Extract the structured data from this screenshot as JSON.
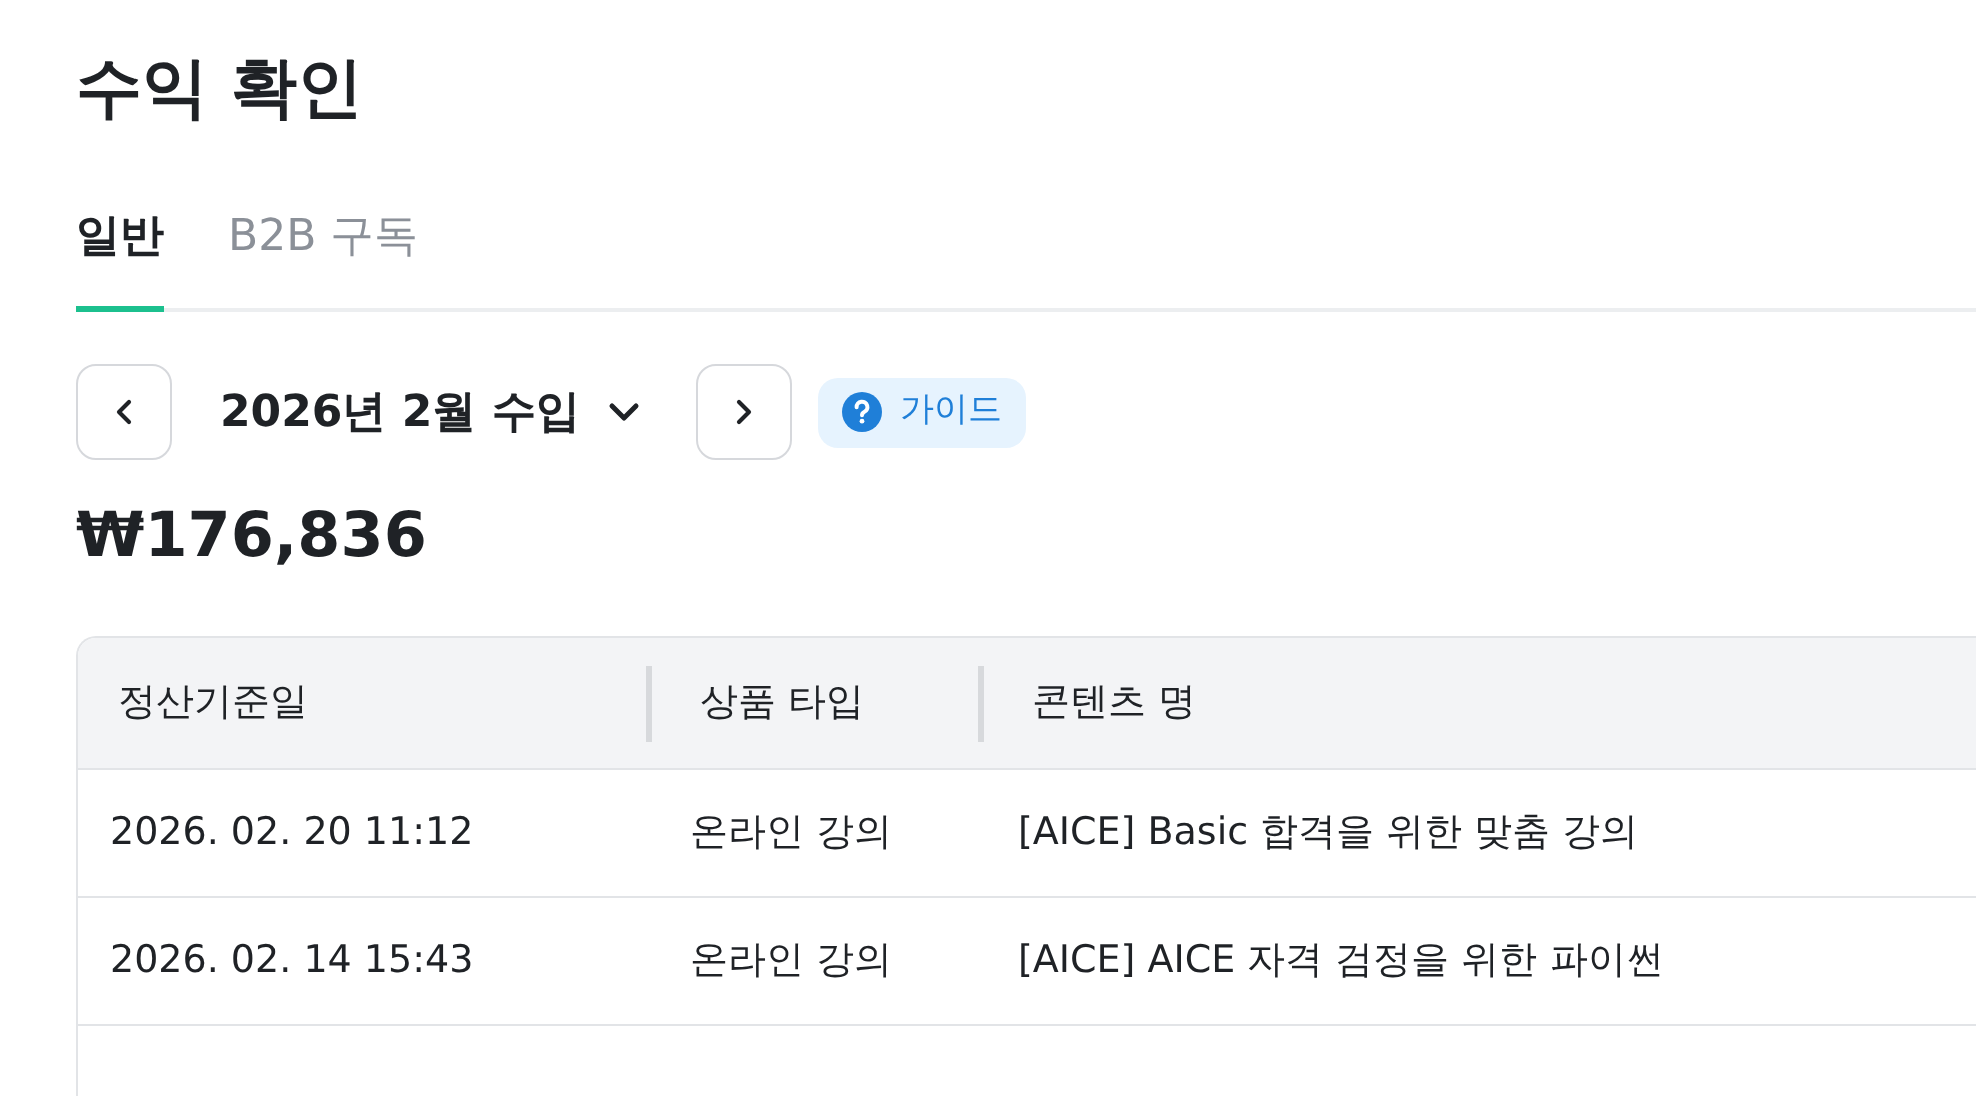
{
  "title": "수익 확인",
  "tabs": [
    {
      "label": "일반",
      "selected": true
    },
    {
      "label": "B2B 구독",
      "selected": false
    }
  ],
  "period": {
    "label": "2026년 2월 수입"
  },
  "guide": {
    "label": "가이드"
  },
  "total": "₩176,836",
  "table": {
    "columns": [
      "정산기준일",
      "상품 타입",
      "콘텐츠 명"
    ],
    "rows": [
      [
        "2026. 02. 20 11:12",
        "온라인 강의",
        "[AICE] Basic 합격을 위한 맞춤 강의"
      ],
      [
        "2026. 02. 14 15:43",
        "온라인 강의",
        "[AICE] AICE 자격 검정을 위한 파이썬"
      ]
    ]
  }
}
